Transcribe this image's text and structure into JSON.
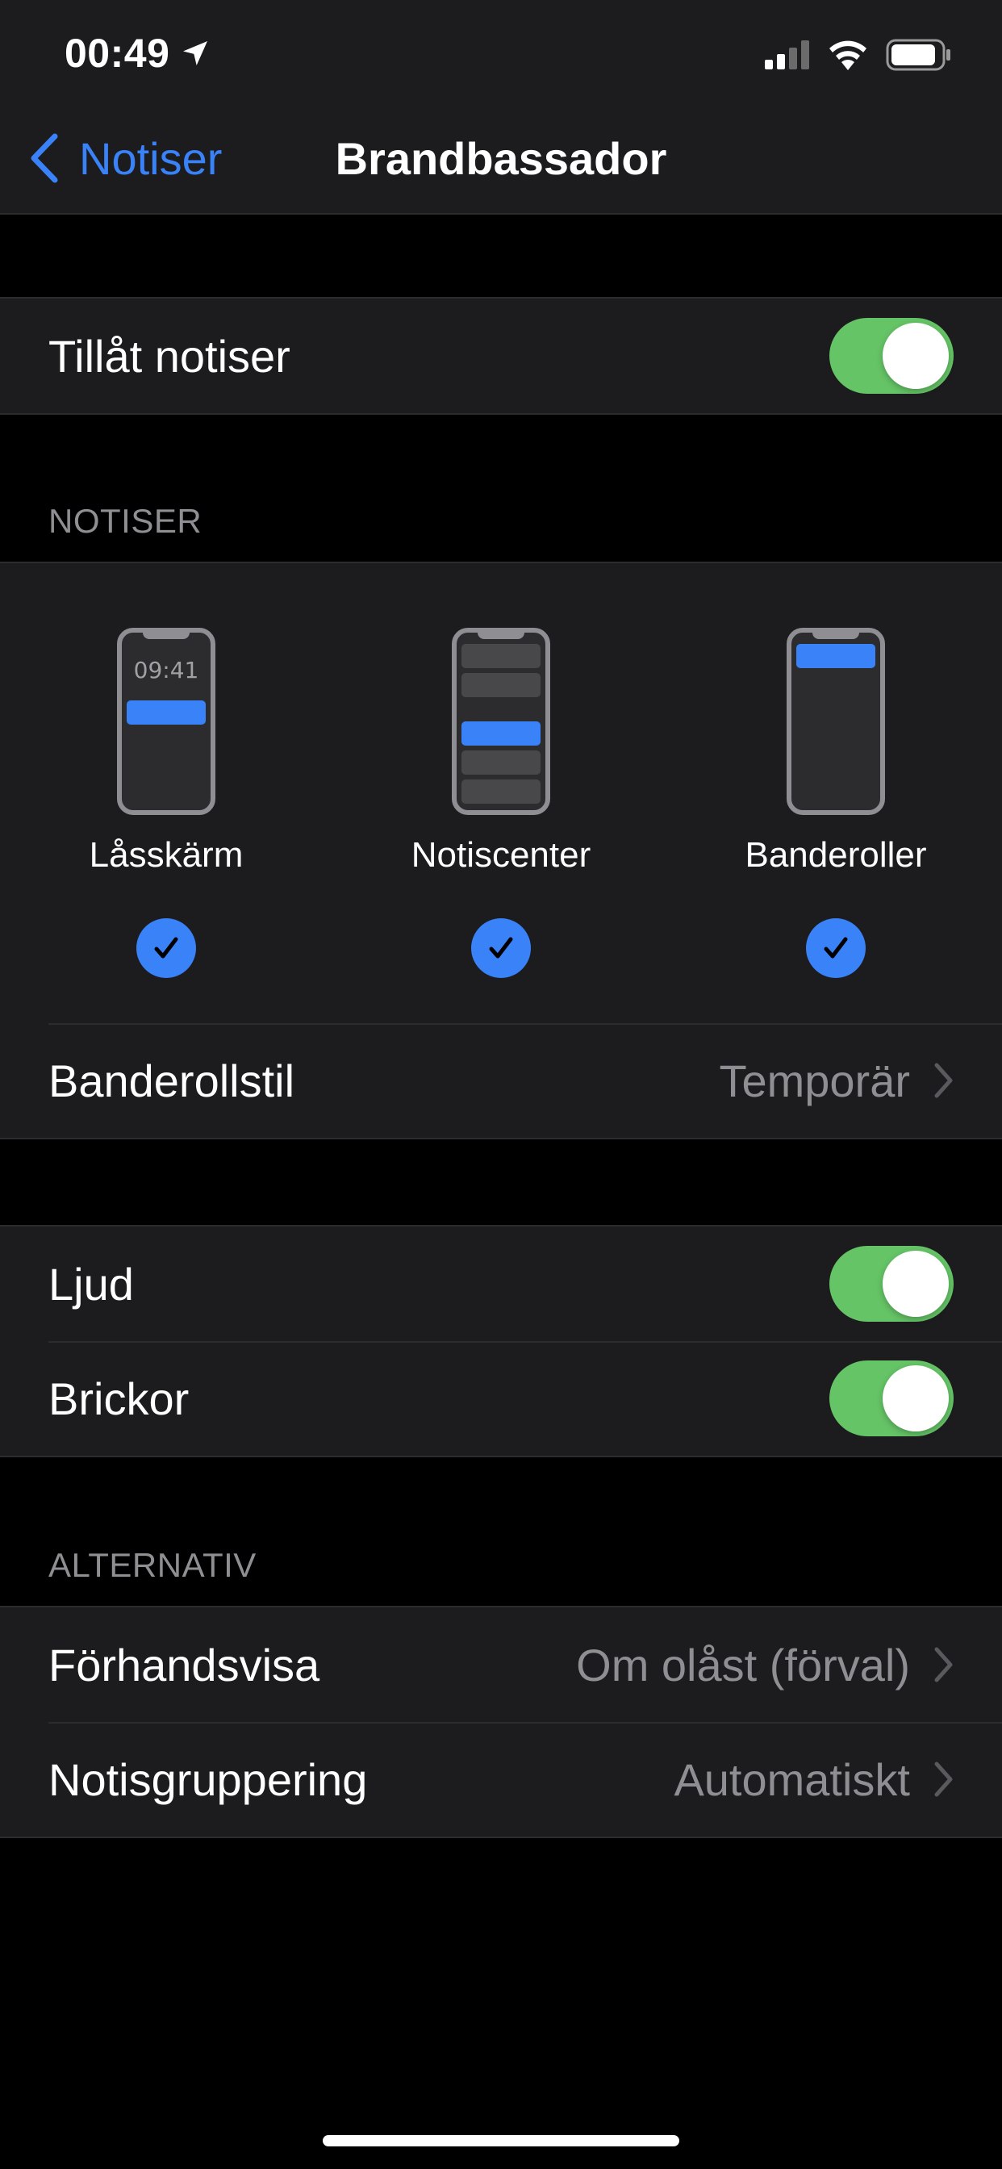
{
  "status_bar": {
    "time": "00:49",
    "location_icon": "location-arrow-icon",
    "signal_icon": "cellular-signal-icon",
    "wifi_icon": "wifi-icon",
    "battery_icon": "battery-icon"
  },
  "nav": {
    "back_label": "Notiser",
    "title": "Brandbassador"
  },
  "allow": {
    "label": "Tillåt notiser",
    "enabled": true
  },
  "notifications_section": {
    "header": "NOTISER",
    "options": [
      {
        "label": "Låsskärm",
        "preview_time": "09:41",
        "checked": true
      },
      {
        "label": "Notiscenter",
        "checked": true
      },
      {
        "label": "Banderoller",
        "checked": true
      }
    ],
    "banner_style": {
      "label": "Banderollstil",
      "value": "Temporär"
    }
  },
  "sound_badges": {
    "sound": {
      "label": "Ljud",
      "enabled": true
    },
    "badges": {
      "label": "Brickor",
      "enabled": true
    }
  },
  "options_section": {
    "header": "ALTERNATIV",
    "preview": {
      "label": "Förhandsvisa",
      "value": "Om olåst (förval)"
    },
    "grouping": {
      "label": "Notisgruppering",
      "value": "Automatiskt"
    }
  },
  "colors": {
    "accent": "#3a82f7",
    "toggle_on": "#65c466",
    "background": "#000000",
    "cell": "#1c1c1e",
    "secondary_text": "#8e8e93"
  }
}
